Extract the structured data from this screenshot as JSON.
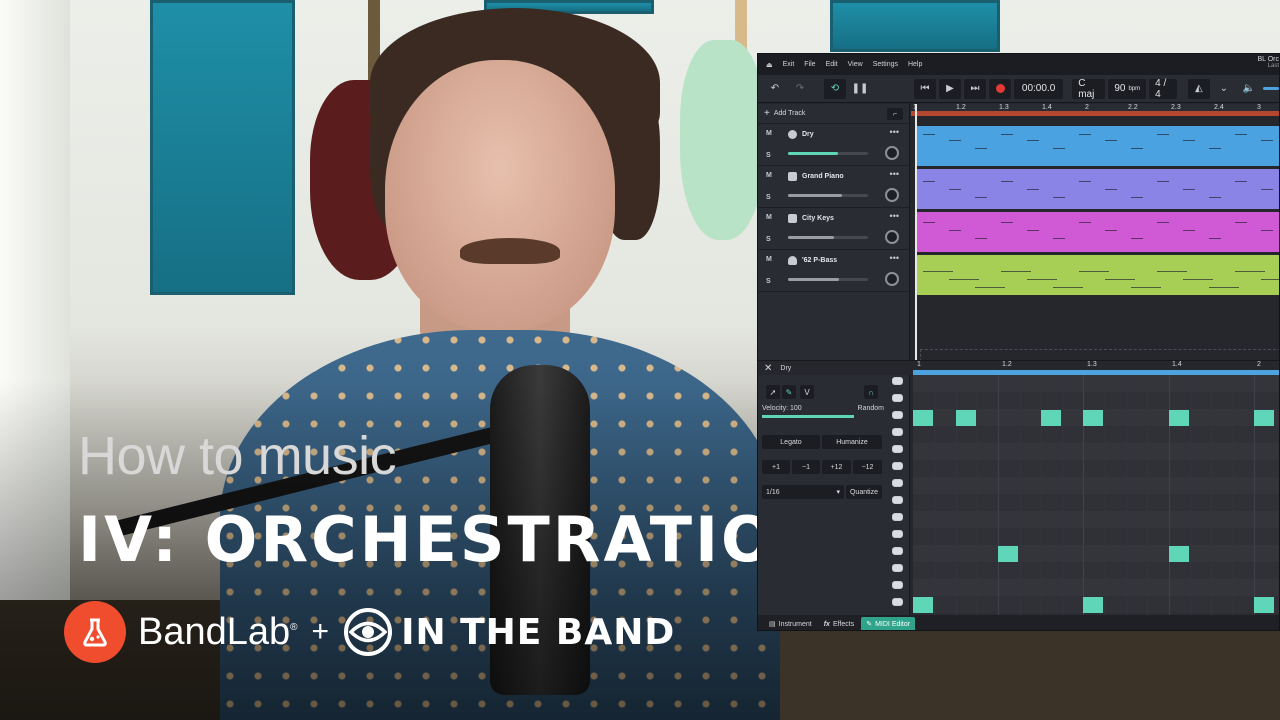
{
  "overlay": {
    "line1": "How to music",
    "line2": "IV: ORCHESTRATION",
    "brand1": "BandLab",
    "registered": "®",
    "plus": "+",
    "brand2": "IN THE BAND"
  },
  "daw": {
    "menu": {
      "exit": "Exit",
      "items": [
        "File",
        "Edit",
        "View",
        "Settings",
        "Help"
      ],
      "project_title": "BL Orc",
      "project_sub": "Last"
    },
    "transport": {
      "time": "00:00.0",
      "key": "C maj",
      "bpm": "90",
      "bpm_unit": "bpm",
      "time_sig": "4 / 4"
    },
    "add_track": "Add Track",
    "ruler": [
      "1",
      "1.2",
      "1.3",
      "1.4",
      "2",
      "2.2",
      "2.3",
      "2.4",
      "3"
    ],
    "tracks": [
      {
        "name": "Dry",
        "m": "M",
        "s": "S",
        "color": "#4aa3e0",
        "volume": 0.62
      },
      {
        "name": "Grand Piano",
        "m": "M",
        "s": "S",
        "color": "#8a84e6",
        "volume": 0.68
      },
      {
        "name": "City Keys",
        "m": "M",
        "s": "S",
        "color": "#d05ad6",
        "volume": 0.58
      },
      {
        "name": "'62 P-Bass",
        "m": "M",
        "s": "S",
        "color": "#a7cf55",
        "volume": 0.64
      }
    ],
    "editor": {
      "title": "Dry",
      "velocity_label": "Velocity: 100",
      "random": "Random",
      "legato": "Legato",
      "humanize": "Humanize",
      "transpose": [
        "+1",
        "−1",
        "+12",
        "−12"
      ],
      "grid": "1/16",
      "quantize": "Quantize",
      "ruler": [
        "1",
        "1.2",
        "1.3",
        "1.4",
        "2"
      ],
      "tabs": [
        "Instrument",
        "Effects",
        "MIDI Editor"
      ],
      "effects_prefix": "fx"
    }
  },
  "colors": {
    "accent_red": "#f04d2f",
    "note_green": "#5fd6b8",
    "loop_red": "#b5472f"
  }
}
